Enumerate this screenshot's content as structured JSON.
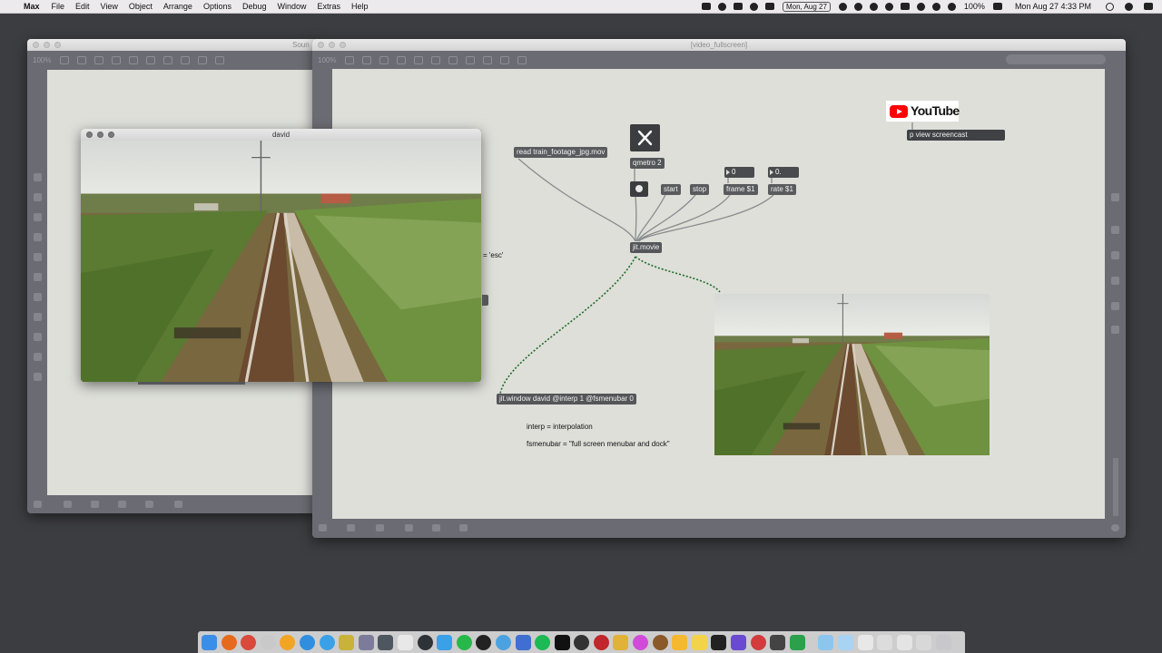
{
  "menubar": {
    "app_name": "Max",
    "menus": [
      "File",
      "Edit",
      "View",
      "Object",
      "Arrange",
      "Options",
      "Debug",
      "Window",
      "Extras",
      "Help"
    ],
    "date_badge": "Mon, Aug 27",
    "battery": "100%",
    "clock": "Mon Aug 27  4:33 PM"
  },
  "back_window": {
    "title": "Soun",
    "zoom": "100%",
    "obscured_comment": "= 'esc'"
  },
  "main_window": {
    "title": "[video_fullscreen]",
    "zoom": "100%"
  },
  "david_window": {
    "title": "david"
  },
  "patch": {
    "read_message": "read train_footage_jpg.mov",
    "qmetro": "qmetro 2",
    "start": "start",
    "stop": "stop",
    "frame_number": "0",
    "rate_number": "0.",
    "frame_message": "frame $1",
    "rate_message": "rate $1",
    "jit_movie": "jit.movie",
    "jit_window": "jit.window david @interp 1 @fsmenubar 0",
    "comment_interp": "interp = interpolation",
    "comment_fsmenubar": "fsmenubar = \"full screen menubar and dock\"",
    "youtube_logo": "YouTube",
    "pview": "p view screencast"
  },
  "colors": {
    "desktop": "#3c3d40",
    "patch_canvas": "#dedfd9",
    "object": "#545659",
    "video_cord": "#1f6b2a",
    "youtube_red": "#ff0000"
  },
  "dock": {
    "item_count": 38
  }
}
